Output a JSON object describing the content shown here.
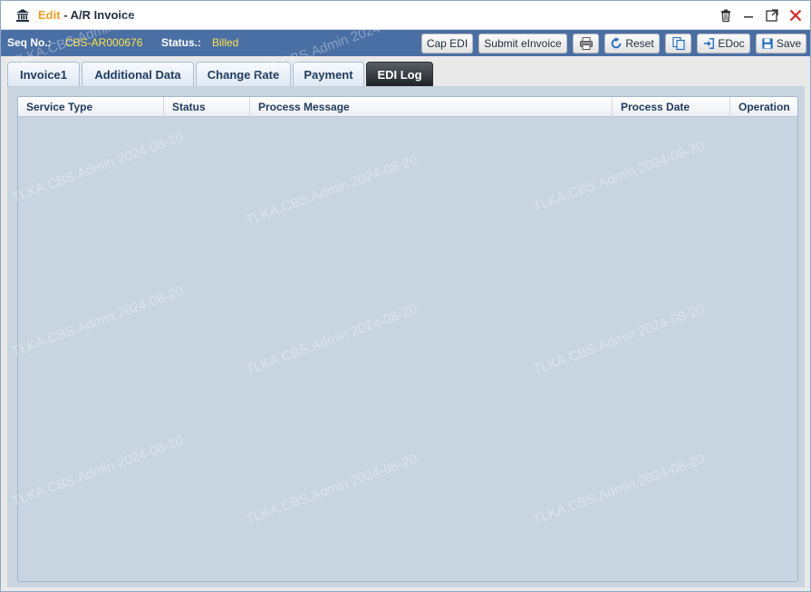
{
  "window": {
    "mode_label": "Edit",
    "separator": "-",
    "title": "A/R Invoice",
    "icons": [
      "bank-icon",
      "trash-icon",
      "minimize-icon",
      "maximize-icon",
      "close-icon"
    ]
  },
  "info": {
    "seq_label": "Seq No.:",
    "seq_value": "CBS-AR000676",
    "status_label": "Status.:",
    "status_value": "Billed"
  },
  "toolbar": {
    "cap_edi": "Cap EDI",
    "submit_einvoice": "Submit eInvoice",
    "reset": "Reset",
    "edoc": "EDoc",
    "save": "Save"
  },
  "tabs": [
    {
      "label": "Invoice1"
    },
    {
      "label": "Additional Data"
    },
    {
      "label": "Change Rate"
    },
    {
      "label": "Payment"
    },
    {
      "label": "EDI Log",
      "active": true
    }
  ],
  "grid": {
    "columns": [
      "Service Type",
      "Status",
      "Process Message",
      "Process Date",
      "Operation"
    ],
    "rows": []
  },
  "watermark": "TLKA.CBS.Admin 2024-08-20",
  "colors": {
    "infobar": "#4a6fa5",
    "accent_yellow": "#ffe14d",
    "edit_orange": "#f0a020",
    "close_red": "#e02020",
    "grid_bg": "#c8d4df"
  }
}
